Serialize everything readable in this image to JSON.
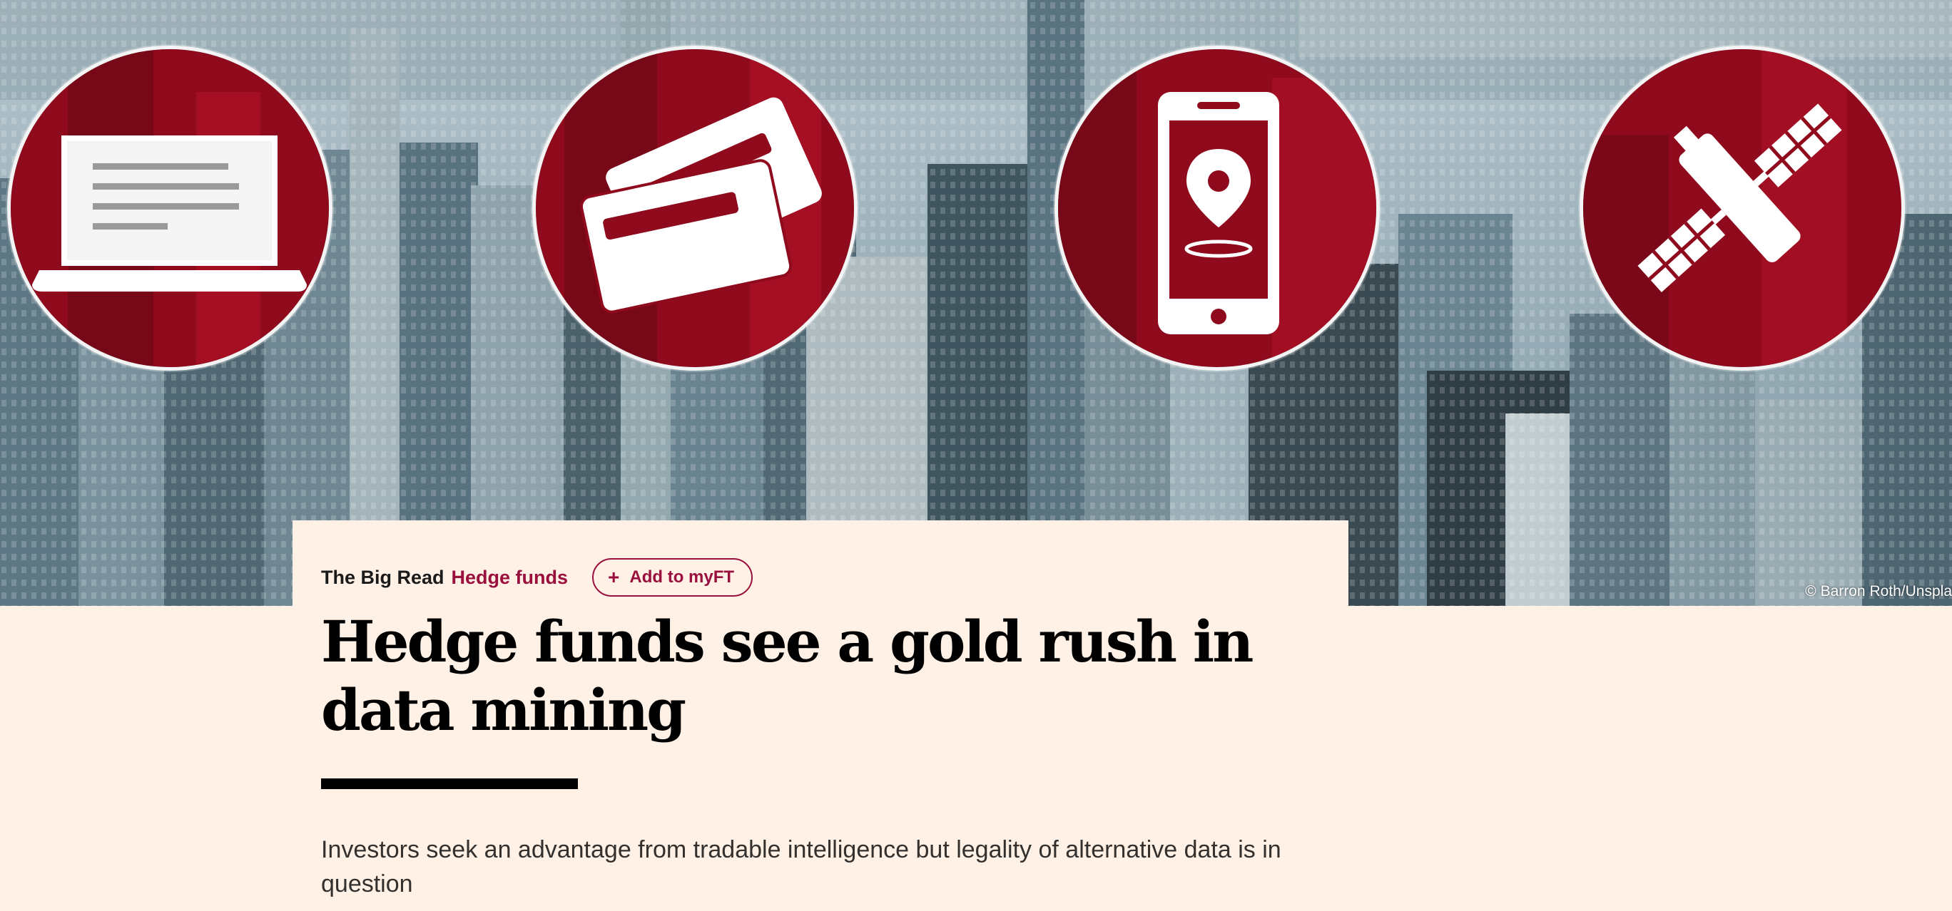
{
  "hero": {
    "credit": "© Barron Roth/Unspla",
    "icons": [
      "laptop-icon",
      "credit-card-icon",
      "smartphone-location-icon",
      "satellite-icon"
    ]
  },
  "article": {
    "series": "The Big Read",
    "topic": "Hedge funds",
    "myft_label": "Add to myFT",
    "headline": "Hedge funds see a gold rush in data mining",
    "standfirst": "Investors seek an advantage from tradable intelligence but legality of alternative data is in question"
  },
  "colors": {
    "page_background": "#FFF1E5",
    "accent_claret": "#990F3D",
    "badge_red": "#9b0b1f",
    "text_dark": "#000000"
  }
}
